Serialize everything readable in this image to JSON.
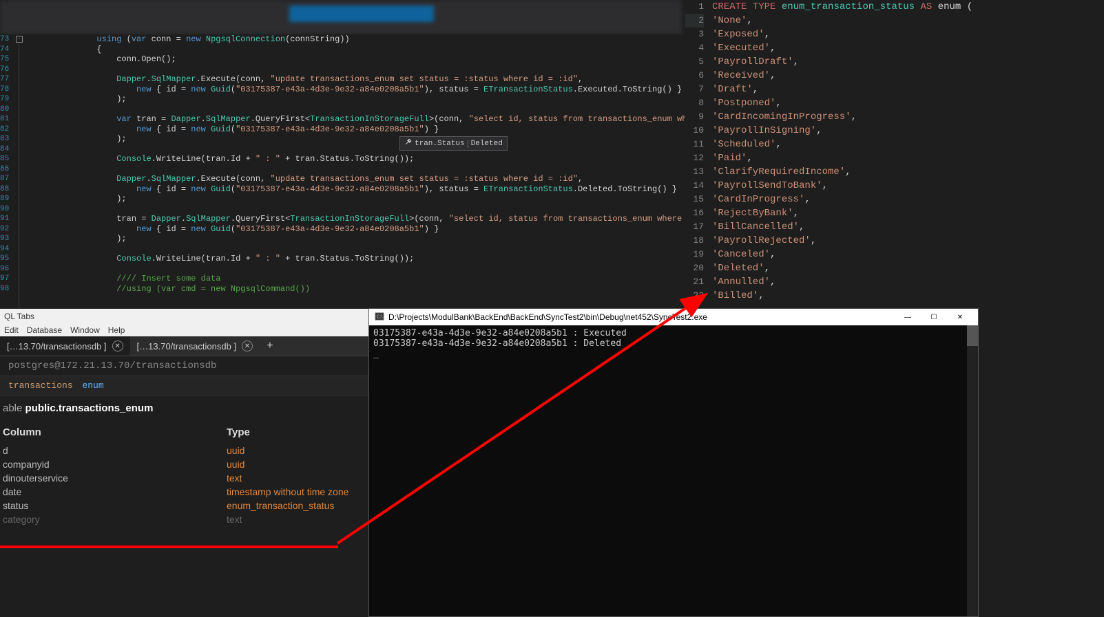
{
  "left_editor": {
    "line_start": 73,
    "line_end": 98,
    "tokens": [
      {
        "l": 73,
        "t": [
          {
            "c": "kw-blue",
            "x": "using"
          },
          {
            "x": " ("
          },
          {
            "c": "kw-blue",
            "x": "var"
          },
          {
            "x": " conn = "
          },
          {
            "c": "kw-blue",
            "x": "new"
          },
          {
            "x": " "
          },
          {
            "c": "kw-type",
            "x": "NpgsqlConnection"
          },
          {
            "x": "(connString))"
          }
        ]
      },
      {
        "l": 74,
        "t": [
          {
            "x": "{"
          }
        ]
      },
      {
        "l": 75,
        "t": [
          {
            "x": "    conn.Open();"
          }
        ]
      },
      {
        "l": 76,
        "t": [
          {
            "x": ""
          }
        ]
      },
      {
        "l": 77,
        "t": [
          {
            "x": "    "
          },
          {
            "c": "kw-type",
            "x": "Dapper"
          },
          {
            "x": "."
          },
          {
            "c": "kw-type",
            "x": "SqlMapper"
          },
          {
            "x": ".Execute(conn, "
          },
          {
            "c": "kw-str",
            "x": "\"update transactions_enum set status = :status where id = :id\""
          },
          {
            "x": ","
          }
        ]
      },
      {
        "l": 78,
        "t": [
          {
            "x": "        "
          },
          {
            "c": "kw-blue",
            "x": "new"
          },
          {
            "x": " { id = "
          },
          {
            "c": "kw-blue",
            "x": "new"
          },
          {
            "x": " "
          },
          {
            "c": "kw-type",
            "x": "Guid"
          },
          {
            "x": "("
          },
          {
            "c": "kw-str",
            "x": "\"03175387-e43a-4d3e-9e32-a84e0208a5b1\""
          },
          {
            "x": "), status = "
          },
          {
            "c": "kw-type",
            "x": "ETransactionStatus"
          },
          {
            "x": ".Executed.ToString() }"
          }
        ]
      },
      {
        "l": 79,
        "t": [
          {
            "x": "    );"
          }
        ]
      },
      {
        "l": 80,
        "t": [
          {
            "x": ""
          }
        ]
      },
      {
        "l": 81,
        "t": [
          {
            "x": "    "
          },
          {
            "c": "kw-blue",
            "x": "var"
          },
          {
            "x": " tran = "
          },
          {
            "c": "kw-type",
            "x": "Dapper"
          },
          {
            "x": "."
          },
          {
            "c": "kw-type",
            "x": "SqlMapper"
          },
          {
            "x": ".QueryFirst<"
          },
          {
            "c": "kw-type",
            "x": "TransactionInStorageFull"
          },
          {
            "x": ">(conn, "
          },
          {
            "c": "kw-str",
            "x": "\"select id, status from transactions_enum where id = :id\""
          },
          {
            "x": ","
          }
        ]
      },
      {
        "l": 82,
        "t": [
          {
            "x": "        "
          },
          {
            "c": "kw-blue",
            "x": "new"
          },
          {
            "x": " { id = "
          },
          {
            "c": "kw-blue",
            "x": "new"
          },
          {
            "x": " "
          },
          {
            "c": "kw-type",
            "x": "Guid"
          },
          {
            "x": "("
          },
          {
            "c": "kw-str",
            "x": "\"03175387-e43a-4d3e-9e32-a84e0208a5b1\""
          },
          {
            "x": ") }"
          }
        ]
      },
      {
        "l": 83,
        "t": [
          {
            "x": "    );"
          }
        ]
      },
      {
        "l": 84,
        "t": [
          {
            "x": ""
          }
        ]
      },
      {
        "l": 85,
        "t": [
          {
            "x": "    "
          },
          {
            "c": "kw-type",
            "x": "Console"
          },
          {
            "x": ".WriteLine(tran.Id + "
          },
          {
            "c": "kw-str",
            "x": "\" : \""
          },
          {
            "x": " + tran.Status.ToString());"
          }
        ]
      },
      {
        "l": 86,
        "t": [
          {
            "x": ""
          }
        ]
      },
      {
        "l": 87,
        "t": [
          {
            "x": "    "
          },
          {
            "c": "kw-type",
            "x": "Dapper"
          },
          {
            "x": "."
          },
          {
            "c": "kw-type",
            "x": "SqlMapper"
          },
          {
            "x": ".Execute(conn, "
          },
          {
            "c": "kw-str",
            "x": "\"update transactions_enum set status = :status where id = :id\""
          },
          {
            "x": ","
          }
        ]
      },
      {
        "l": 88,
        "t": [
          {
            "x": "        "
          },
          {
            "c": "kw-blue",
            "x": "new"
          },
          {
            "x": " { id = "
          },
          {
            "c": "kw-blue",
            "x": "new"
          },
          {
            "x": " "
          },
          {
            "c": "kw-type",
            "x": "Guid"
          },
          {
            "x": "("
          },
          {
            "c": "kw-str",
            "x": "\"03175387-e43a-4d3e-9e32-a84e0208a5b1\""
          },
          {
            "x": "), status = "
          },
          {
            "c": "kw-type",
            "x": "ETransactionStatus"
          },
          {
            "x": ".Deleted.ToString() }"
          }
        ]
      },
      {
        "l": 89,
        "t": [
          {
            "x": "    );"
          }
        ]
      },
      {
        "l": 90,
        "t": [
          {
            "x": ""
          }
        ]
      },
      {
        "l": 91,
        "t": [
          {
            "x": "    tran = "
          },
          {
            "c": "kw-type",
            "x": "Dapper"
          },
          {
            "x": "."
          },
          {
            "c": "kw-type",
            "x": "SqlMapper"
          },
          {
            "x": ".QueryFirst<"
          },
          {
            "c": "kw-type",
            "x": "TransactionInStorageFull"
          },
          {
            "x": ">(conn, "
          },
          {
            "c": "kw-str",
            "x": "\"select id, status from transactions_enum where id = :id\""
          },
          {
            "x": ","
          }
        ]
      },
      {
        "l": 92,
        "t": [
          {
            "x": "        "
          },
          {
            "c": "kw-blue",
            "x": "new"
          },
          {
            "x": " { id = "
          },
          {
            "c": "kw-blue",
            "x": "new"
          },
          {
            "x": " "
          },
          {
            "c": "kw-type",
            "x": "Guid"
          },
          {
            "x": "("
          },
          {
            "c": "kw-str",
            "x": "\"03175387-e43a-4d3e-9e32-a84e0208a5b1\""
          },
          {
            "x": ") }"
          }
        ]
      },
      {
        "l": 93,
        "t": [
          {
            "x": "    );"
          }
        ]
      },
      {
        "l": 94,
        "t": [
          {
            "x": ""
          }
        ]
      },
      {
        "l": 95,
        "t": [
          {
            "x": "    "
          },
          {
            "c": "kw-type",
            "x": "Console"
          },
          {
            "x": ".WriteLine(tran.Id + "
          },
          {
            "c": "kw-str",
            "x": "\" : \""
          },
          {
            "x": " + tran.Status.ToString());"
          }
        ]
      },
      {
        "l": 96,
        "t": [
          {
            "x": ""
          }
        ]
      },
      {
        "l": 97,
        "t": [
          {
            "x": "    "
          },
          {
            "c": "kw-comment",
            "x": "//// Insert some data"
          }
        ]
      },
      {
        "l": 98,
        "t": [
          {
            "x": "    "
          },
          {
            "c": "kw-comment",
            "x": "//using (var cmd = new NpgsqlCommand())"
          }
        ]
      }
    ],
    "tooltip": {
      "icon": "wrench-icon",
      "field": "tran.Status",
      "value": "Deleted"
    }
  },
  "right_editor": {
    "line_start": 1,
    "line_end": 22,
    "active_line": 2,
    "tokens": [
      {
        "l": 1,
        "t": [
          {
            "c": "sql-red",
            "x": "CREATE"
          },
          {
            "x": " "
          },
          {
            "c": "sql-red",
            "x": "TYPE"
          },
          {
            "x": " "
          },
          {
            "c": "sql-type",
            "x": "enum_transaction_status"
          },
          {
            "x": " "
          },
          {
            "c": "sql-red",
            "x": "AS"
          },
          {
            "x": " enum ("
          }
        ]
      },
      {
        "l": 2,
        "t": [
          {
            "c": "sql-str",
            "x": "'None'"
          },
          {
            "x": ","
          }
        ]
      },
      {
        "l": 3,
        "t": [
          {
            "c": "sql-str",
            "x": "'Exposed'"
          },
          {
            "x": ","
          }
        ]
      },
      {
        "l": 4,
        "t": [
          {
            "c": "sql-str",
            "x": "'Executed'"
          },
          {
            "x": ","
          }
        ]
      },
      {
        "l": 5,
        "t": [
          {
            "c": "sql-str",
            "x": "'PayrollDraft'"
          },
          {
            "x": ","
          }
        ]
      },
      {
        "l": 6,
        "t": [
          {
            "c": "sql-str",
            "x": "'Received'"
          },
          {
            "x": ","
          }
        ]
      },
      {
        "l": 7,
        "t": [
          {
            "c": "sql-str",
            "x": "'Draft'"
          },
          {
            "x": ","
          }
        ]
      },
      {
        "l": 8,
        "t": [
          {
            "c": "sql-str",
            "x": "'Postponed'"
          },
          {
            "x": ","
          }
        ]
      },
      {
        "l": 9,
        "t": [
          {
            "c": "sql-str",
            "x": "'CardIncomingInProgress'"
          },
          {
            "x": ","
          }
        ]
      },
      {
        "l": 10,
        "t": [
          {
            "c": "sql-str",
            "x": "'PayrollInSigning'"
          },
          {
            "x": ","
          }
        ]
      },
      {
        "l": 11,
        "t": [
          {
            "c": "sql-str",
            "x": "'Scheduled'"
          },
          {
            "x": ","
          }
        ]
      },
      {
        "l": 12,
        "t": [
          {
            "c": "sql-str",
            "x": "'Paid'"
          },
          {
            "x": ","
          }
        ]
      },
      {
        "l": 13,
        "t": [
          {
            "c": "sql-str",
            "x": "'ClarifyRequiredIncome'"
          },
          {
            "x": ","
          }
        ]
      },
      {
        "l": 14,
        "t": [
          {
            "c": "sql-str",
            "x": "'PayrollSendToBank'"
          },
          {
            "x": ","
          }
        ]
      },
      {
        "l": 15,
        "t": [
          {
            "c": "sql-str",
            "x": "'CardInProgress'"
          },
          {
            "x": ","
          }
        ]
      },
      {
        "l": 16,
        "t": [
          {
            "c": "sql-str",
            "x": "'RejectByBank'"
          },
          {
            "x": ","
          }
        ]
      },
      {
        "l": 17,
        "t": [
          {
            "c": "sql-str",
            "x": "'BillCancelled'"
          },
          {
            "x": ","
          }
        ]
      },
      {
        "l": 18,
        "t": [
          {
            "c": "sql-str",
            "x": "'PayrollRejected'"
          },
          {
            "x": ","
          }
        ]
      },
      {
        "l": 19,
        "t": [
          {
            "c": "sql-str",
            "x": "'Canceled'"
          },
          {
            "x": ","
          }
        ]
      },
      {
        "l": 20,
        "t": [
          {
            "c": "sql-str",
            "x": "'Deleted'"
          },
          {
            "x": ","
          }
        ]
      },
      {
        "l": 21,
        "t": [
          {
            "c": "sql-str",
            "x": "'Annulled'"
          },
          {
            "x": ","
          }
        ]
      },
      {
        "l": 22,
        "t": [
          {
            "c": "sql-str",
            "x": "'Billed'"
          },
          {
            "x": ","
          }
        ]
      }
    ]
  },
  "qltabs": {
    "title": "QL Tabs",
    "menu": [
      "Edit",
      "Database",
      "Window",
      "Help"
    ],
    "tabs": [
      {
        "label": "[…13.70/transactionsdb ]"
      },
      {
        "label": "[…13.70/transactionsdb ]"
      }
    ],
    "plus": "+",
    "addr": "postgres@172.21.13.70/transactionsdb",
    "crumb": {
      "seg1": "transactions",
      "seg2": "enum"
    },
    "heading_prefix": "able ",
    "heading_bold": "public.transactions_enum",
    "col_header": "Column",
    "type_header": "Type",
    "rows": [
      {
        "col": "d",
        "type": "uuid"
      },
      {
        "col": "companyid",
        "type": "uuid"
      },
      {
        "col": "dinouterservice",
        "type": "text"
      },
      {
        "col": "date",
        "type": "timestamp without time zone"
      },
      {
        "col": "status",
        "type": "enum_transaction_status"
      },
      {
        "col": "category",
        "type": "text",
        "strike": true
      }
    ]
  },
  "console": {
    "title_icon": "cmd-icon",
    "title": "D:\\Projects\\ModulBank\\BackEnd\\BackEnd\\SyncTest2\\bin\\Debug\\net452\\SyncTest2.exe",
    "lines": [
      "03175387-e43a-4d3e-9e32-a84e0208a5b1 : Executed",
      "03175387-e43a-4d3e-9e32-a84e0208a5b1 : Deleted"
    ],
    "minimize": "—",
    "maximize": "☐",
    "close": "✕",
    "cursor": "_"
  }
}
